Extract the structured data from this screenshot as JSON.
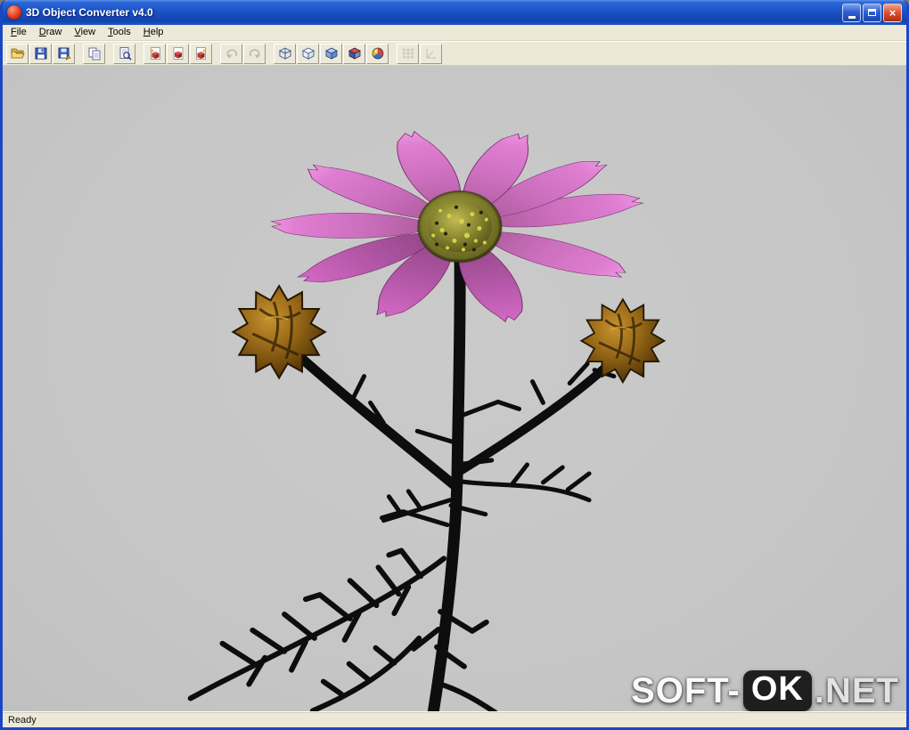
{
  "window": {
    "title": "3D Object Converter v4.0",
    "icon": "app-icon-red-sphere",
    "controls": {
      "close_glyph": "×"
    }
  },
  "menubar": {
    "items": [
      {
        "label": "File"
      },
      {
        "label": "Draw"
      },
      {
        "label": "View"
      },
      {
        "label": "Tools"
      },
      {
        "label": "Help"
      }
    ]
  },
  "toolbar": {
    "buttons": [
      {
        "name": "open-file",
        "icon": "folder-open-icon",
        "enabled": true
      },
      {
        "name": "save-file",
        "icon": "floppy-disk-icon",
        "enabled": true
      },
      {
        "name": "save-as",
        "icon": "floppy-export-icon",
        "enabled": true
      },
      {
        "name": "copy",
        "icon": "copy-pages-icon",
        "enabled": true
      },
      {
        "name": "preview",
        "icon": "page-magnifier-icon",
        "enabled": true
      },
      {
        "name": "previous-object",
        "icon": "page-cube-prev-icon",
        "enabled": true
      },
      {
        "name": "object-info",
        "icon": "page-cube-icon",
        "enabled": true
      },
      {
        "name": "next-object",
        "icon": "page-cube-next-icon",
        "enabled": true
      },
      {
        "name": "undo",
        "icon": "undo-arrow-icon",
        "enabled": false
      },
      {
        "name": "redo",
        "icon": "redo-arrow-icon",
        "enabled": false
      },
      {
        "name": "wireframe-view",
        "icon": "cube-wireframe-icon",
        "enabled": true
      },
      {
        "name": "hidden-line-view",
        "icon": "cube-hidden-icon",
        "enabled": true
      },
      {
        "name": "flat-shaded-view",
        "icon": "cube-flat-icon",
        "enabled": true
      },
      {
        "name": "smooth-shaded-view",
        "icon": "cube-colored-icon",
        "enabled": true
      },
      {
        "name": "textured-view",
        "icon": "sphere-color-icon",
        "enabled": true
      },
      {
        "name": "grid-toggle",
        "icon": "grid-icon",
        "enabled": false
      },
      {
        "name": "axes-toggle",
        "icon": "axes-icon",
        "enabled": false
      }
    ]
  },
  "viewport": {
    "background": "#c6c6c6",
    "model_description": "3D cosmos flower model: pink blossom with yellow-green center disc, two golden-brown buds, black thorny stems and fern leaves",
    "colors": {
      "petal": "#d978c8",
      "petal_dark": "#a0509a",
      "disc": "#84822e",
      "bud": "#9a6a18",
      "stem": "#0d0d0d"
    }
  },
  "statusbar": {
    "text": "Ready"
  },
  "watermark": {
    "prefix": "SOFT-",
    "boxed": "OK",
    "suffix": ".NET"
  }
}
